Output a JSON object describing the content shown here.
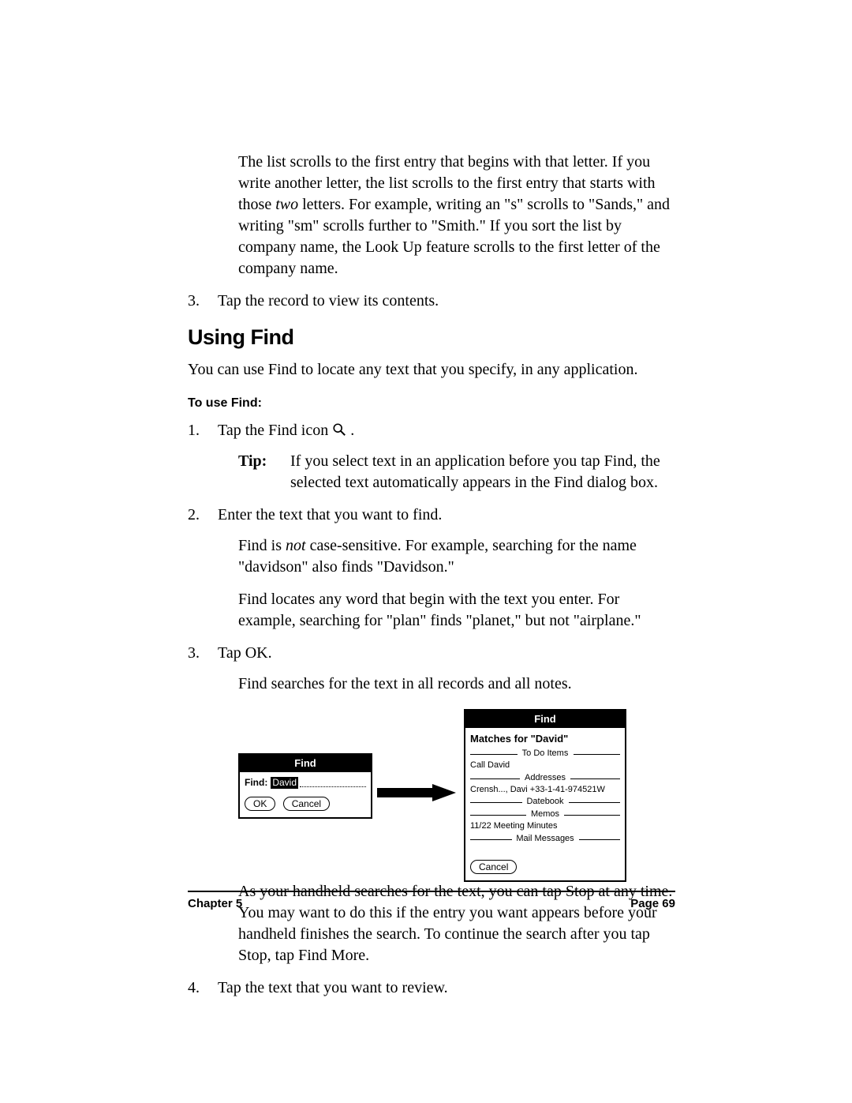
{
  "body": {
    "lookup_para": "The list scrolls to the first entry that begins with that letter. If you write another letter, the list scrolls to the first entry that starts with those ",
    "lookup_para_em": "two",
    "lookup_para_after": " letters. For example, writing an \"s\" scrolls to \"Sands,\" and writing \"sm\" scrolls further to \"Smith.\" If you sort the list by company name, the Look Up feature scrolls to the first letter of the company name.",
    "step3_lookup": "Tap the record to view its contents.",
    "heading": "Using Find",
    "intro": "You can use Find to locate any text that you specify, in any application.",
    "subheading": "To use Find:",
    "steps": {
      "n1": "1.",
      "n2": "2.",
      "n3": "3.",
      "n4": "4.",
      "s1_before": "Tap the Find icon ",
      "s1_after": ".",
      "tip_label": "Tip:",
      "tip_text": "If you select text in an application before you tap Find, the selected text automatically appears in the Find dialog box.",
      "s2": "Enter the text that you want to find.",
      "s2a_before": "Find is ",
      "s2a_em": "not",
      "s2a_after": " case-sensitive. For example, searching for the name \"davidson\" also finds \"Davidson.\"",
      "s2b": "Find locates any word that begin with the text you enter. For example, searching for \"plan\" finds \"planet,\" but not \"airplane.\"",
      "s3": "Tap OK.",
      "s3a": "Find searches for the text in all records and all notes.",
      "s3b": "As your handheld searches for the text, you can tap Stop at any time. You may want to do this if the entry you want appears before your handheld finishes the search. To continue the search after you tap Stop, tap Find More.",
      "s4": "Tap the text that you want to review."
    }
  },
  "figure": {
    "left": {
      "title": "Find",
      "find_label": "Find:",
      "find_value": "David",
      "ok": "OK",
      "cancel": "Cancel"
    },
    "right": {
      "title": "Find",
      "matches": "Matches for \"David\"",
      "cat1": "To Do Items",
      "item1": "Call David",
      "cat2": "Addresses",
      "item2": "Crensh..., Davi    +33-1-41-974521W",
      "cat3": "Datebook",
      "cat4": "Memos",
      "item3": "11/22 Meeting Minutes",
      "cat5": "Mail Messages",
      "cancel": "Cancel"
    }
  },
  "footer": {
    "chapter": "Chapter 5",
    "page": "Page 69"
  }
}
